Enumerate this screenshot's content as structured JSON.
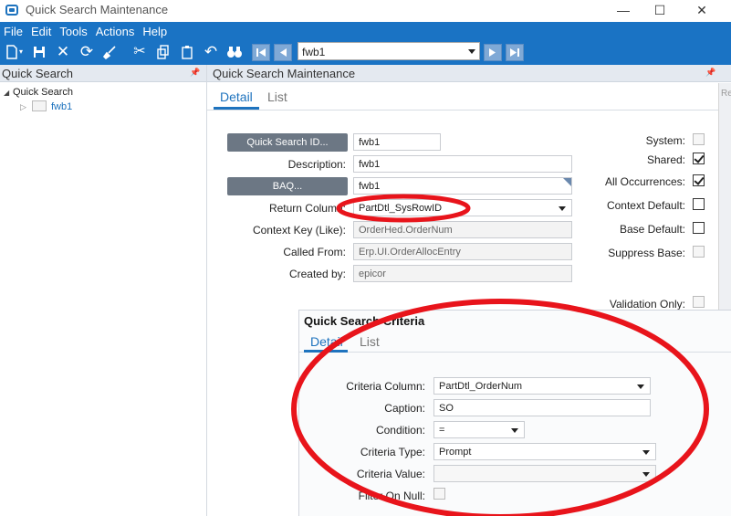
{
  "window": {
    "title": "Quick Search Maintenance",
    "minimize": "—",
    "maximize": "☐",
    "close": "✕"
  },
  "menu": [
    "File",
    "Edit",
    "Tools",
    "Actions",
    "Help"
  ],
  "toolbar": {
    "record_combo_value": "fwb1"
  },
  "left_pane": {
    "header": "Quick Search",
    "tree_root": "Quick Search",
    "tree_child": "fwb1"
  },
  "main": {
    "header": "Quick Search Maintenance",
    "tabs": [
      "Detail",
      "List"
    ],
    "edge_text": "Re",
    "buttons": {
      "quick_search_id": "Quick Search ID...",
      "baq": "BAQ..."
    },
    "fields": {
      "quick_search_id": "fwb1",
      "description_label": "Description:",
      "description": "fwb1",
      "baq": "fwb1",
      "return_column_label": "Return Column:",
      "return_column": "PartDtl_SysRowID",
      "context_key_label": "Context Key (Like):",
      "context_key": "OrderHed.OrderNum",
      "called_from_label": "Called From:",
      "called_from": "Erp.UI.OrderAllocEntry",
      "created_by_label": "Created by:",
      "created_by": "epicor"
    },
    "checkboxes": {
      "system": "System:",
      "shared": "Shared:",
      "all_occurrences": "All Occurrences:",
      "context_default": "Context Default:",
      "base_default": "Base Default:",
      "suppress_base": "Suppress Base:",
      "validation_only": "Validation Only:"
    },
    "checkbox_states": {
      "system": false,
      "shared": true,
      "all_occurrences": true,
      "context_default": false,
      "base_default": false,
      "suppress_base": false,
      "validation_only": false
    }
  },
  "criteria": {
    "title": "Quick Search Criteria",
    "tabs": [
      "Detail",
      "List"
    ],
    "labels": {
      "criteria_column": "Criteria Column:",
      "caption": "Caption:",
      "condition": "Condition:",
      "criteria_type": "Criteria Type:",
      "criteria_value": "Criteria Value:",
      "filter_on_null": "Filter On Null:"
    },
    "values": {
      "criteria_column": "PartDtl_OrderNum",
      "caption": "SO",
      "condition": "=",
      "criteria_type": "Prompt",
      "criteria_value": ""
    }
  },
  "colors": {
    "accent": "#1a73c4",
    "annotation": "#e8141b",
    "button_grey": "#6c7784"
  }
}
